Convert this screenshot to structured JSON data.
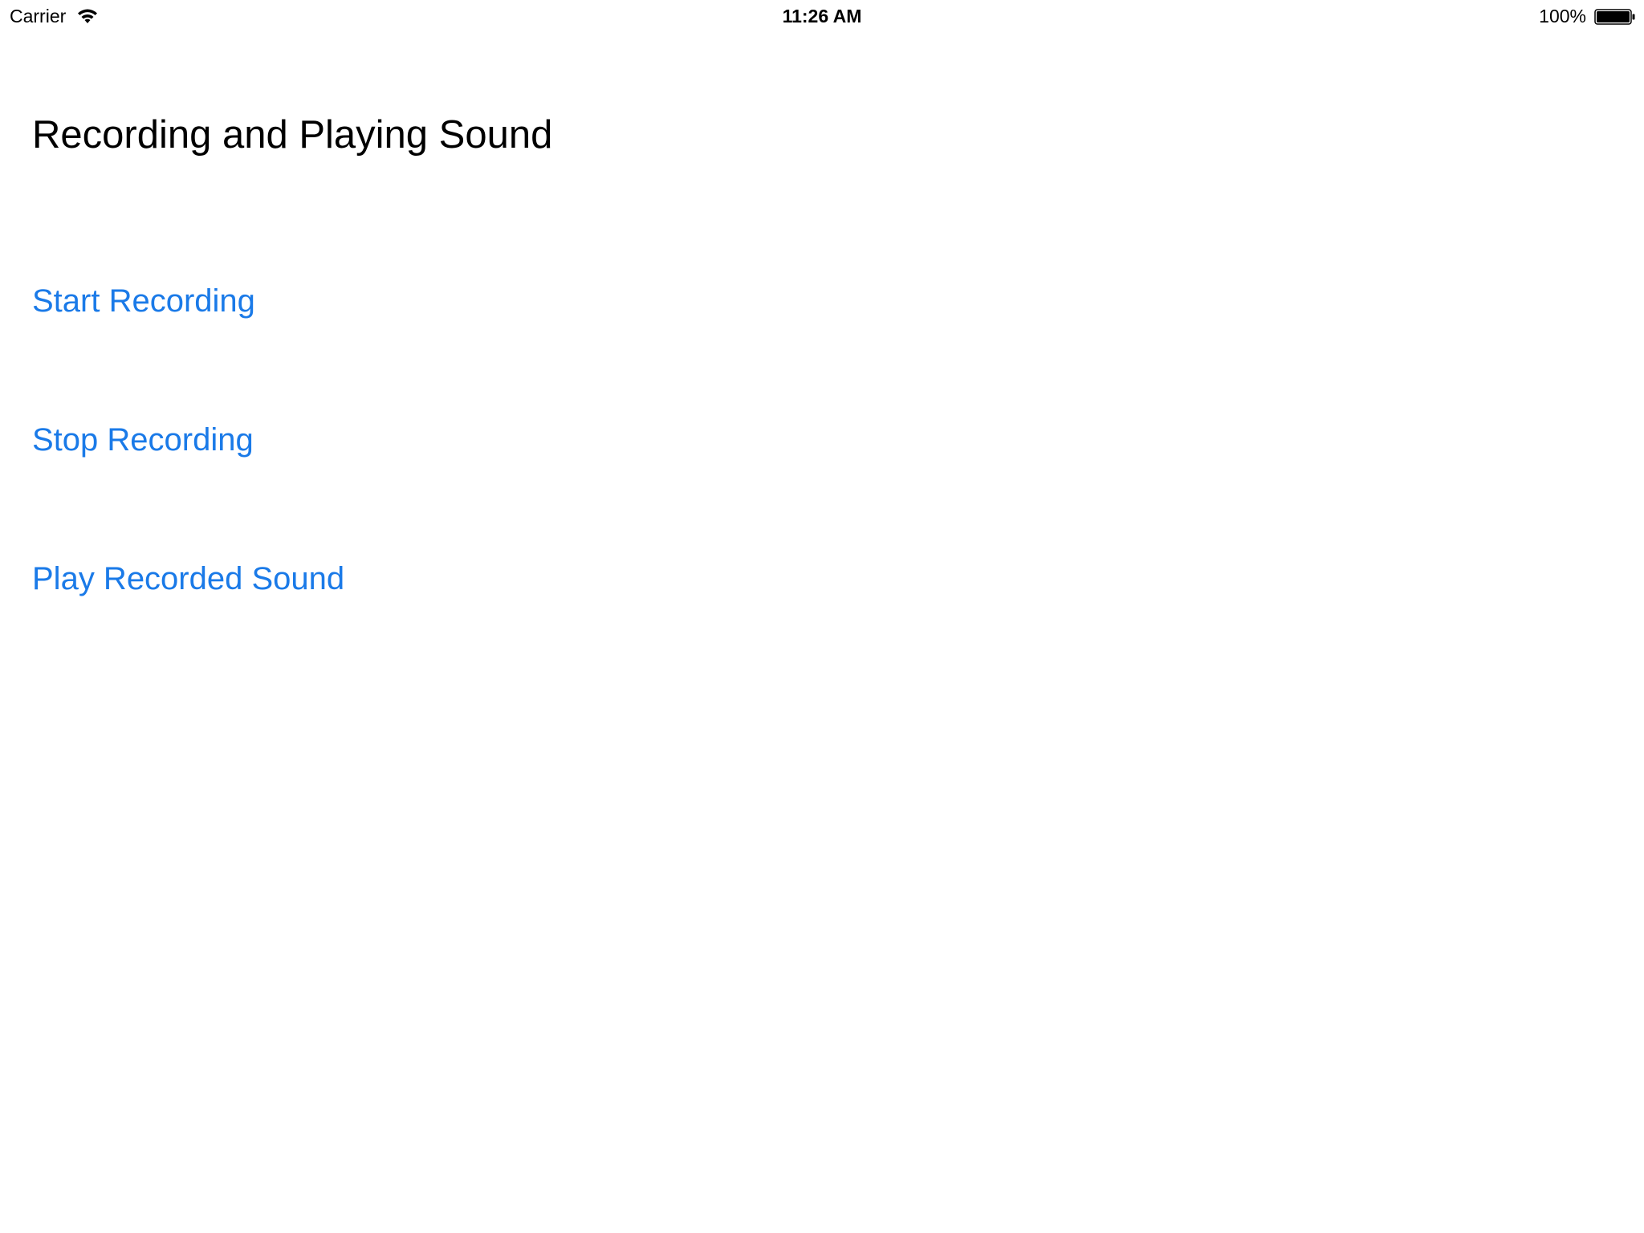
{
  "status_bar": {
    "carrier": "Carrier",
    "time": "11:26 AM",
    "battery_percent": "100%",
    "battery_level": 1.0,
    "wifi_icon": "wifi-icon",
    "battery_icon": "battery-icon"
  },
  "page": {
    "title": "Recording and Playing Sound"
  },
  "buttons": {
    "start_recording": "Start Recording",
    "stop_recording": "Stop Recording",
    "play_recorded_sound": "Play Recorded Sound"
  },
  "colors": {
    "tint": "#1a7ae8",
    "text": "#000000",
    "background": "#ffffff"
  }
}
